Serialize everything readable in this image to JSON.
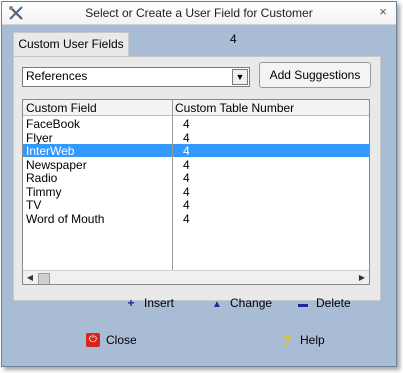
{
  "window": {
    "title": "Select or Create a User Field for Customer",
    "app_icon": "tools-icon",
    "close_icon": "close-icon",
    "close_glyph": "×"
  },
  "tab": {
    "label": "Custom User Fields"
  },
  "count": "4",
  "dropdown": {
    "selected": "References",
    "arrow_glyph": "▼"
  },
  "add_suggestions": {
    "label": "Add Suggestions"
  },
  "list": {
    "columns": [
      "Custom Field",
      "Custom Table Number"
    ],
    "rows": [
      {
        "field": "FaceBook",
        "number": "4",
        "selected": false
      },
      {
        "field": "Flyer",
        "number": "4",
        "selected": false
      },
      {
        "field": "InterWeb",
        "number": "4",
        "selected": true
      },
      {
        "field": "Newspaper",
        "number": "4",
        "selected": false
      },
      {
        "field": "Radio",
        "number": "4",
        "selected": false
      },
      {
        "field": "Timmy",
        "number": "4",
        "selected": false
      },
      {
        "field": "TV",
        "number": "4",
        "selected": false
      },
      {
        "field": "Word of Mouth",
        "number": "4",
        "selected": false
      }
    ],
    "scroll_left_glyph": "◀",
    "scroll_right_glyph": "▶"
  },
  "actions": {
    "insert": {
      "label": "Insert",
      "glyph": "+"
    },
    "change": {
      "label": "Change",
      "glyph": "▲"
    },
    "delete": {
      "label": "Delete",
      "glyph": "▬"
    }
  },
  "footer": {
    "close": {
      "label": "Close",
      "glyph": "⏻"
    },
    "help": {
      "label": "Help",
      "glyph": "?"
    }
  },
  "colors": {
    "window_bg": "#a9bcd6",
    "selection": "#3399ff",
    "action_icon": "#1a2a9a",
    "power_red": "#d9231d",
    "help_yellow": "#e0c500"
  }
}
